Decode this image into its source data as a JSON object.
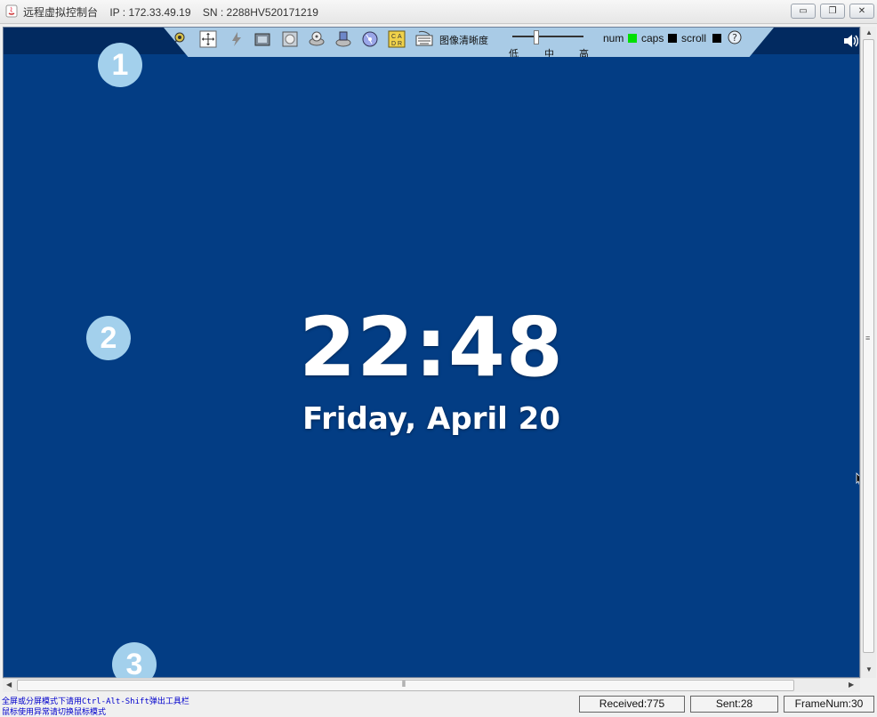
{
  "window": {
    "title": "远程虚拟控制台    IP : 172.33.49.19    SN : 2288HV520171219",
    "minimize_glyph": "▭",
    "restore_glyph": "❐",
    "close_glyph": "✕"
  },
  "toolbar": {
    "icons": [
      "gear-icon",
      "move-icon",
      "lightning-icon",
      "camera-icon",
      "cd-image-icon",
      "disk-icon",
      "floppy-icon",
      "cd-drive-icon",
      "letters-icon",
      "keyboard-icon"
    ],
    "quality_label": "图像清晰度",
    "quality_ticks": [
      "低",
      "中",
      "高"
    ],
    "quality_level": 0.33,
    "lock_keys": [
      {
        "label": "num",
        "color": "#00e000"
      },
      {
        "label": "caps",
        "color": "#000000"
      },
      {
        "label": "scroll",
        "color": "#000000"
      }
    ],
    "help_icon": "question-icon",
    "speaker_icon": "speaker-icon"
  },
  "screen": {
    "background": "#033d84",
    "time": "22:48",
    "date": "Friday, April 20"
  },
  "badges": [
    "1",
    "2",
    "3"
  ],
  "status": {
    "hint_line1": "全屏或分屏模式下请用Ctrl-Alt-Shift弹出工具栏",
    "hint_line2": "鼠标使用异常请切换鼠标模式",
    "received": "Received:775",
    "sent": "Sent:28",
    "frame_num": "FrameNum:30"
  }
}
